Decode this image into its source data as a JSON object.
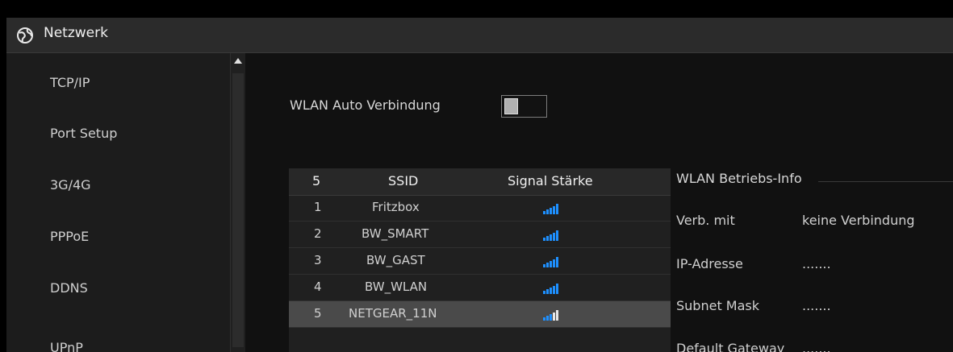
{
  "window": {
    "title": "Netzwerk",
    "icon": "globe-network-icon"
  },
  "sidebar": {
    "items": [
      {
        "label": "TCP/IP"
      },
      {
        "label": "Port Setup"
      },
      {
        "label": "3G/4G"
      },
      {
        "label": "PPPoE"
      },
      {
        "label": "DDNS"
      },
      {
        "label": "UPnP"
      }
    ]
  },
  "wlan_auto": {
    "label": "WLAN Auto Verbindung",
    "enabled": false
  },
  "wifi_table": {
    "headers": {
      "count": "5",
      "ssid": "SSID",
      "signal": "Signal Stärke"
    },
    "rows": [
      {
        "num": "1",
        "ssid": "Fritzbox",
        "signal_bars": 5
      },
      {
        "num": "2",
        "ssid": "BW_SMART",
        "signal_bars": 5
      },
      {
        "num": "3",
        "ssid": "BW_GAST",
        "signal_bars": 5
      },
      {
        "num": "4",
        "ssid": "BW_WLAN",
        "signal_bars": 5
      },
      {
        "num": "5",
        "ssid": "NETGEAR_11N",
        "signal_bars": 3,
        "selected": true
      }
    ]
  },
  "info": {
    "title": "WLAN Betriebs-Info",
    "fields": [
      {
        "label": "Verb. mit",
        "value": "keine Verbindung"
      },
      {
        "label": "IP-Adresse",
        "value": "......."
      },
      {
        "label": "Subnet Mask",
        "value": "......."
      },
      {
        "label": "Default Gateway",
        "value": "......."
      }
    ]
  },
  "colors": {
    "signal_active": "#1e90ff",
    "signal_inactive": "#e8e8e8",
    "selected_row": "#4a4a4a"
  }
}
